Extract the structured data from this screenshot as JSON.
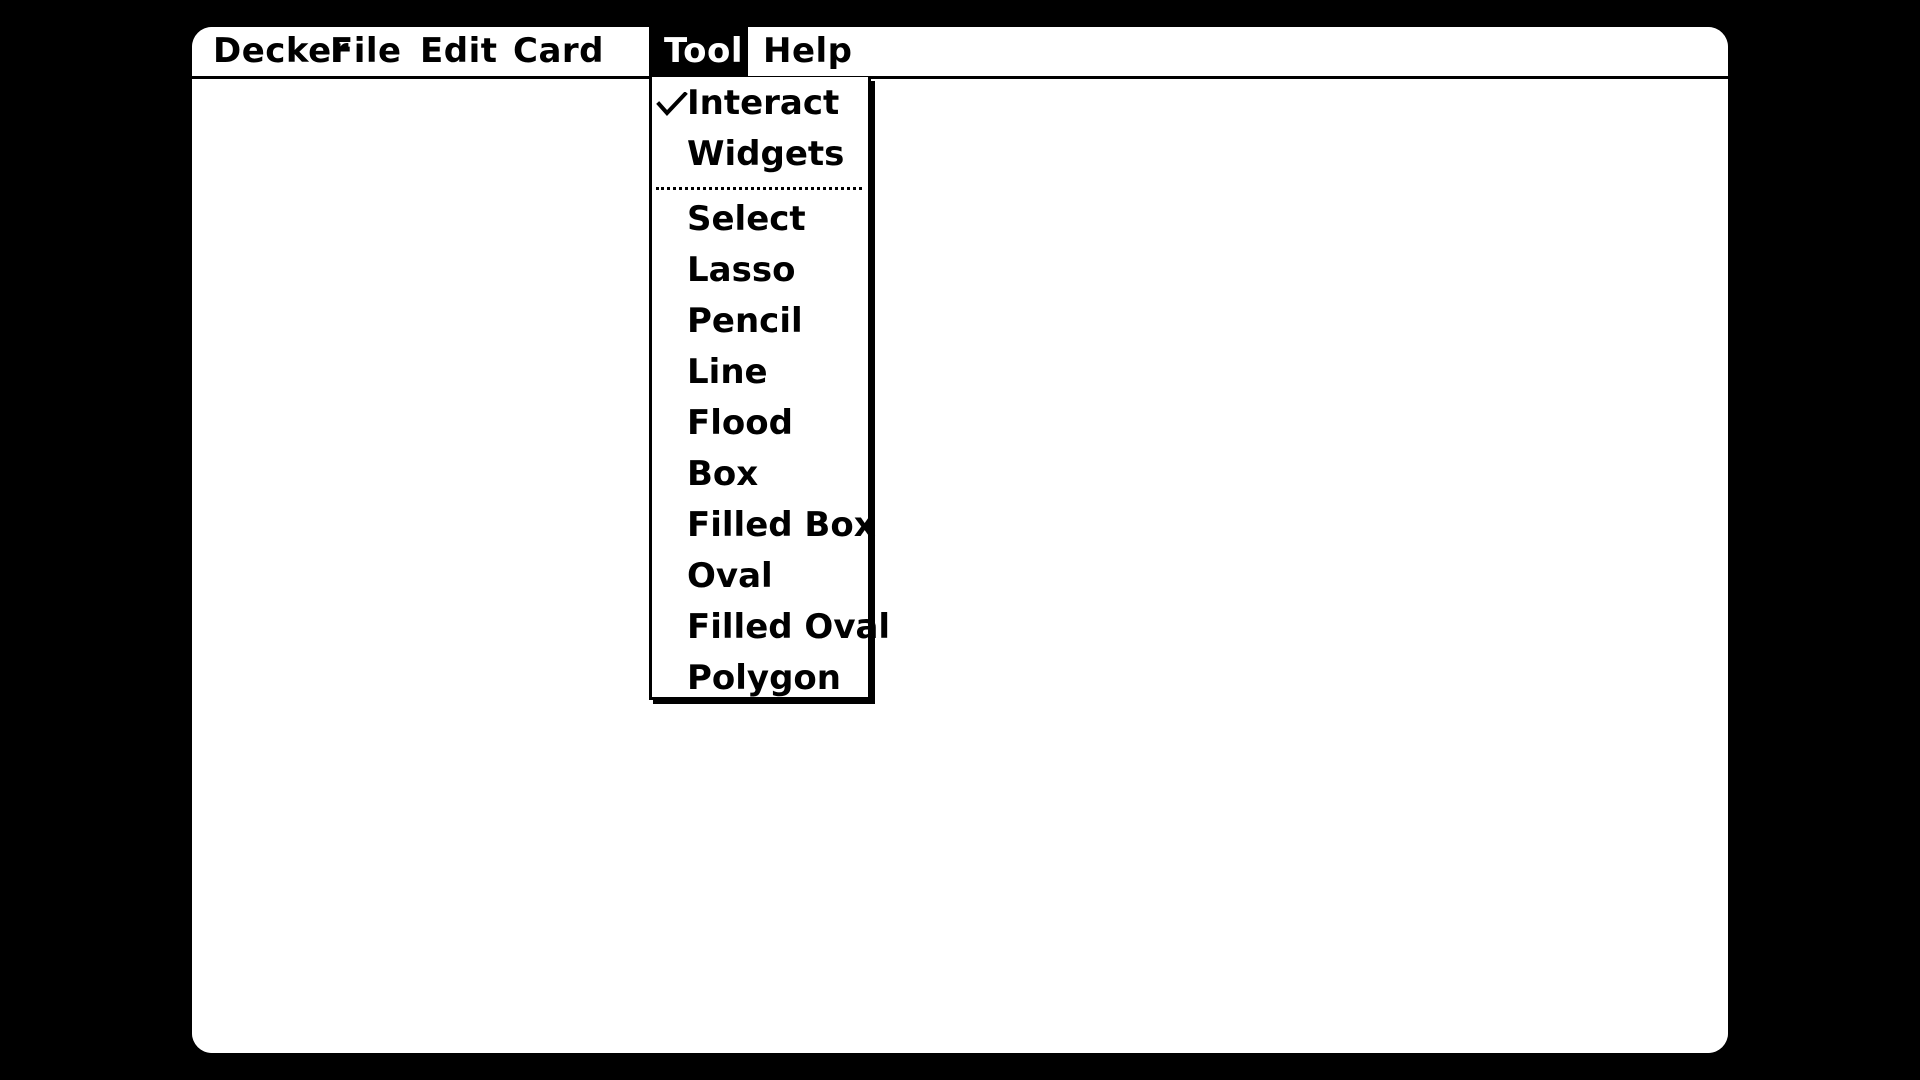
{
  "menubar": {
    "items": [
      {
        "label": "Decker"
      },
      {
        "label": "File"
      },
      {
        "label": "Edit"
      },
      {
        "label": "Card"
      },
      {
        "label": "Tool",
        "open": true
      },
      {
        "label": "Help"
      }
    ]
  },
  "tool_menu": {
    "groups": [
      [
        {
          "label": "Interact",
          "checked": true,
          "icon": "checkmark-icon"
        },
        {
          "label": "Widgets",
          "checked": false
        }
      ],
      [
        {
          "label": "Select"
        },
        {
          "label": "Lasso"
        },
        {
          "label": "Pencil"
        },
        {
          "label": "Line"
        },
        {
          "label": "Flood"
        },
        {
          "label": "Box"
        },
        {
          "label": "Filled Box"
        },
        {
          "label": "Oval"
        },
        {
          "label": "Filled Oval"
        },
        {
          "label": "Polygon"
        }
      ]
    ]
  },
  "colors": {
    "background": "#000000",
    "screen": "#ffffff",
    "ink": "#000000"
  }
}
